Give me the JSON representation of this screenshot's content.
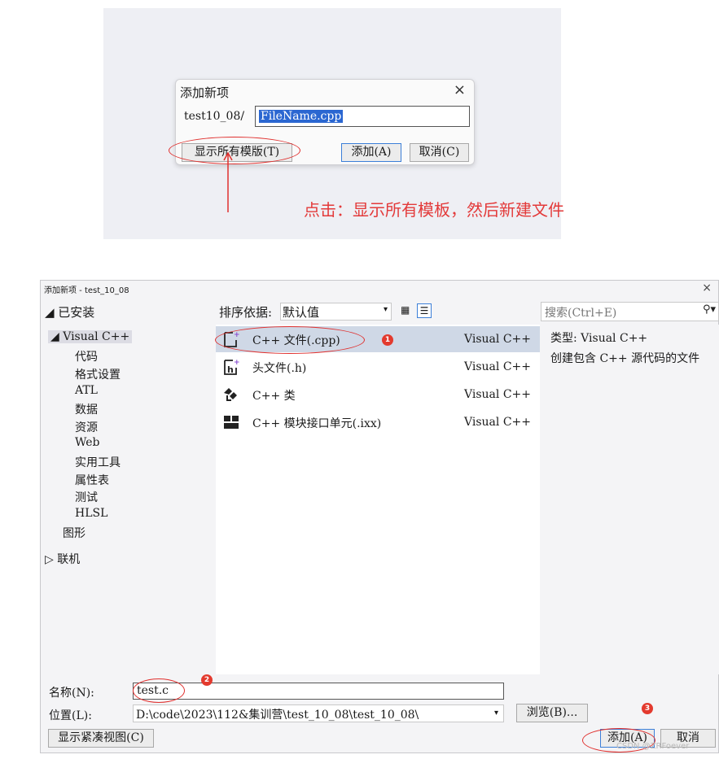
{
  "small_dialog": {
    "title": "添加新项",
    "close": "×",
    "path_label": "test10_08/",
    "filename": "FileName.cpp",
    "show_templates_button": "显示所有模版(T)",
    "add_button": "添加(A)",
    "cancel_button": "取消(C)"
  },
  "annotation": {
    "text": "点击：显示所有模板，然后新建文件",
    "color": "#e33a3a"
  },
  "big_dialog": {
    "title": "添加新项 - test_10_08",
    "close": "×",
    "installed": "◢ 已安装",
    "tree": [
      {
        "label": "◢ Visual C++"
      },
      {
        "label": "代码"
      },
      {
        "label": "格式设置"
      },
      {
        "label": "ATL"
      },
      {
        "label": "数据"
      },
      {
        "label": "资源"
      },
      {
        "label": "Web"
      },
      {
        "label": "实用工具"
      },
      {
        "label": "属性表"
      },
      {
        "label": "测试"
      },
      {
        "label": "HLSL"
      },
      {
        "label": "图形"
      },
      {
        "label": "▷ 联机"
      }
    ],
    "sort_label": "排序依据:",
    "sort_value": "默认值",
    "search_placeholder": "搜索(Ctrl+E)",
    "templates": [
      {
        "name": "C++ 文件(.cpp)",
        "lang": "Visual C++",
        "icon": "cpp-file-icon",
        "selected": true
      },
      {
        "name": "头文件(.h)",
        "lang": "Visual C++",
        "icon": "header-file-icon",
        "selected": false
      },
      {
        "name": "C++ 类",
        "lang": "Visual C++",
        "icon": "class-icon",
        "selected": false
      },
      {
        "name": "C++ 模块接口单元(.ixx)",
        "lang": "Visual C++",
        "icon": "module-icon",
        "selected": false
      }
    ],
    "detail_type": "类型: Visual C++",
    "detail_desc": "创建包含 C++ 源代码的文件",
    "name_label": "名称(N):",
    "name_value": "test.c",
    "location_label": "位置(L):",
    "location_value": "D:\\code\\2023\\112&集训营\\test_10_08\\test_10_08\\",
    "browse_button": "浏览(B)...",
    "compact_view_button": "显示紧凑视图(C)",
    "add_button": "添加(A)",
    "cancel_button": "取消"
  },
  "badges": [
    "1",
    "2",
    "3"
  ],
  "watermark": "CSDN @ZRFoever"
}
